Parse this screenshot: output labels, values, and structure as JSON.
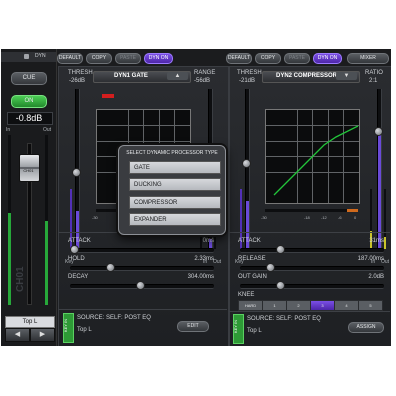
{
  "left_strip": {
    "dyn_label": "DYN",
    "cue_label": "CUE",
    "on_label": "ON",
    "level": "-0.8dB",
    "in_label": "In",
    "out_label": "Out",
    "fader_label": "CH01",
    "channel_name": "CH01",
    "top_label": "Top L"
  },
  "toolbar_left": {
    "default": "DEFAULT",
    "copy": "COPY",
    "paste": "PASTE",
    "dyn_on": "DYN ON"
  },
  "toolbar_right": {
    "default": "DEFAULT",
    "copy": "COPY",
    "paste": "PASTE",
    "dyn_on": "DYN ON",
    "mixer": "MIXER"
  },
  "dyn1": {
    "thresh_label": "THRESH",
    "thresh_value": "-26dB",
    "type_name": "DYN1 GATE",
    "range_label": "RANGE",
    "range_value": "-56dB",
    "key_label": "Key",
    "in_label": "In",
    "out_label": "Out",
    "axis_ticks": [
      "-30",
      "-18",
      "-12",
      "-6",
      "0"
    ],
    "params": [
      {
        "label": "ATTACK",
        "value": "0ms",
        "level": 0.0
      },
      {
        "label": "HOLD",
        "value": "2.33ms",
        "level": 0.32
      },
      {
        "label": "DECAY",
        "value": "304.00ms",
        "level": 0.58
      }
    ],
    "key_in": "KEY IN",
    "source": "SOURCE: SELF: POST EQ",
    "source_channel": "Top L",
    "edit_button": "EDIT"
  },
  "dyn2": {
    "thresh_label": "THRESH",
    "thresh_value": "-21dB",
    "type_name": "DYN2 COMPRESSOR",
    "ratio_label": "RATIO",
    "ratio_value": "2:1",
    "key_label": "Key",
    "in_label": "In",
    "out_label": "Out",
    "axis_ticks": [
      "-30",
      "-18",
      "-12",
      "-6",
      "0"
    ],
    "params": [
      {
        "label": "ATTACK",
        "value": "31ms",
        "level": 0.28
      },
      {
        "label": "RELEASE",
        "value": "187.00ms",
        "level": 0.28
      },
      {
        "label": "OUT GAIN",
        "value": "2.0dB",
        "level": 0.28
      }
    ],
    "knee_label": "KNEE",
    "knee_options": [
      "HARD",
      "1",
      "2",
      "3",
      "4",
      "5"
    ],
    "knee_selected": "3",
    "key_in": "KEY IN",
    "source": "SOURCE: SELF: POST EQ",
    "source_channel": "Top L",
    "assign_button": "ASSIGN"
  },
  "popup": {
    "title": "SELECT DYNAMIC PROCESSOR TYPE",
    "options": [
      "GATE",
      "DUCKING",
      "COMPRESSOR",
      "EXPANDER"
    ]
  },
  "colors": {
    "accent": "#6a3fd6",
    "on_green": "#2fae3a",
    "curve_green": "#22c53a",
    "meter_yellow": "#c9c32a"
  }
}
